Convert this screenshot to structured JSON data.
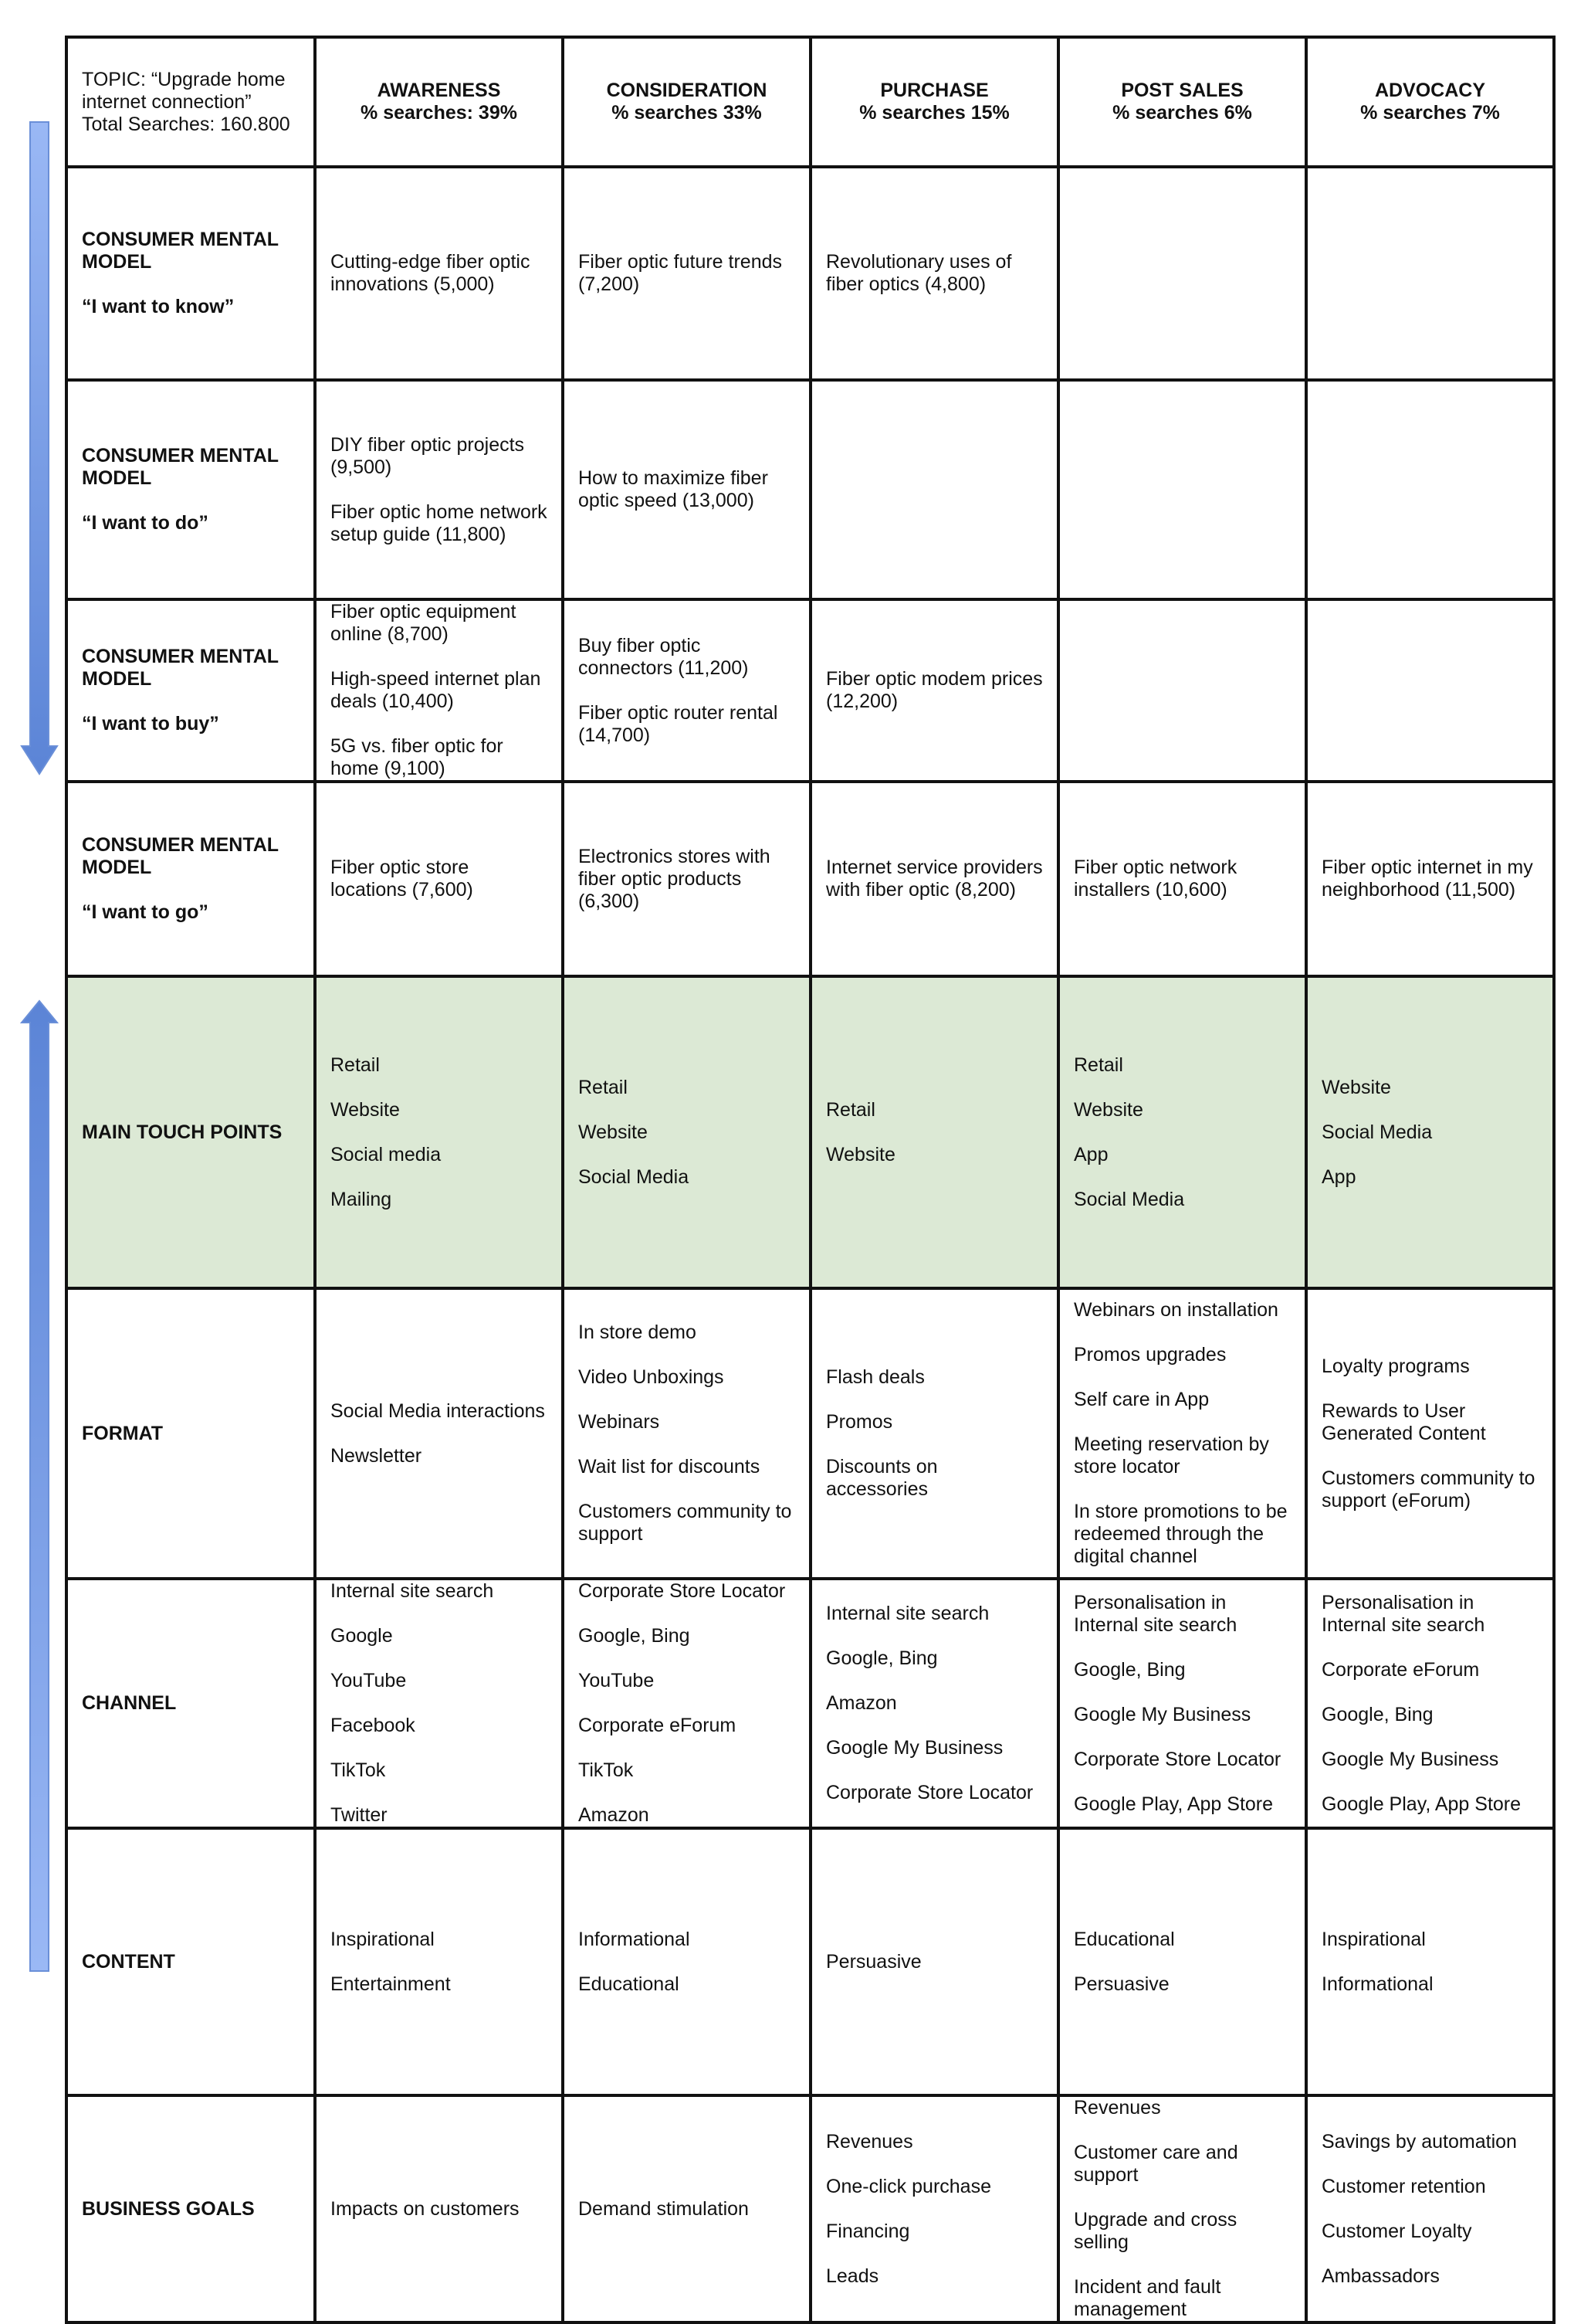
{
  "colors": {
    "border": "#111111",
    "touchpoints_bg": "#dce9d5",
    "arrow_down": "#5b84d6",
    "arrow_up": "#5b84d6",
    "arrow_light": "#9ab8f5"
  },
  "topic": {
    "line1": "TOPIC: “Upgrade home internet connection”",
    "line2": "Total Searches: 160.800"
  },
  "stages": [
    {
      "name": "AWARENESS",
      "searches": "% searches: 39%"
    },
    {
      "name": "CONSIDERATION",
      "searches": "% searches 33%"
    },
    {
      "name": "PURCHASE",
      "searches": "% searches 15%"
    },
    {
      "name": "POST SALES",
      "searches": "% searches 6%"
    },
    {
      "name": "ADVOCACY",
      "searches": "% searches 7%"
    }
  ],
  "rows": [
    {
      "label": "CONSUMER MENTAL MODEL",
      "sub": "“I want to know”",
      "cells": [
        [
          "Cutting-edge fiber optic innovations (5,000)"
        ],
        [
          "Fiber optic future trends (7,200)"
        ],
        [
          "Revolutionary uses of fiber optics (4,800)"
        ],
        [],
        []
      ]
    },
    {
      "label": "CONSUMER MENTAL MODEL",
      "sub": "“I want to do”",
      "cells": [
        [
          "DIY fiber optic projects (9,500)",
          "Fiber optic home network setup guide (11,800)"
        ],
        [
          "How to maximize fiber optic speed (13,000)"
        ],
        [],
        [],
        []
      ]
    },
    {
      "label": "CONSUMER MENTAL MODEL",
      "sub": "“I want to buy”",
      "cells": [
        [
          "Fiber optic equipment online (8,700)",
          "High-speed internet plan deals (10,400)",
          "5G vs. fiber optic for home (9,100)"
        ],
        [
          "Buy fiber optic connectors (11,200)",
          "Fiber optic router rental (14,700)"
        ],
        [
          "Fiber optic modem prices (12,200)"
        ],
        [],
        []
      ]
    },
    {
      "label": "CONSUMER MENTAL MODEL",
      "sub": "“I want to go”",
      "cells": [
        [
          "Fiber optic store locations (7,600)"
        ],
        [
          "Electronics stores with fiber optic products (6,300)"
        ],
        [
          "Internet service providers with fiber optic (8,200)"
        ],
        [
          "Fiber optic network installers (10,600)"
        ],
        [
          "Fiber optic internet in my neighborhood (11,500)"
        ]
      ]
    },
    {
      "label": "MAIN TOUCH POINTS",
      "sub": "",
      "cells": [
        [
          "Retail",
          "Website",
          "Social media",
          "Mailing"
        ],
        [
          "Retail",
          "Website",
          "Social Media"
        ],
        [
          "Retail",
          "Website"
        ],
        [
          "Retail",
          "Website",
          "App",
          "Social Media"
        ],
        [
          "Website",
          "Social Media",
          "App"
        ]
      ]
    },
    {
      "label": "FORMAT",
      "sub": "",
      "cells": [
        [
          "Social Media interactions",
          "Newsletter"
        ],
        [
          "In store demo",
          "Video Unboxings",
          "Webinars",
          "Wait list for discounts",
          "Customers community to support"
        ],
        [
          "Flash deals",
          "Promos",
          "Discounts on accessories"
        ],
        [
          "Webinars on installation",
          "Promos upgrades",
          "Self care in App",
          "Meeting reservation by store locator",
          "In store promotions to be redeemed through the digital channel"
        ],
        [
          "Loyalty programs",
          "Rewards to User Generated Content",
          "Customers community to support (eForum)"
        ]
      ]
    },
    {
      "label": "CHANNEL",
      "sub": "",
      "cells": [
        [
          "Internal site search",
          "Google",
          "YouTube",
          "Facebook",
          "TikTok",
          "Twitter"
        ],
        [
          "Corporate Store Locator",
          "Google, Bing",
          "YouTube",
          "Corporate eForum",
          "TikTok",
          "Amazon"
        ],
        [
          "Internal site search",
          "Google, Bing",
          "Amazon",
          "Google My Business",
          "Corporate Store Locator"
        ],
        [
          "Personalisation in Internal site search",
          "Google, Bing",
          "Google My Business",
          "Corporate Store Locator",
          "Google Play, App Store"
        ],
        [
          "Personalisation in Internal site search",
          "Corporate eForum",
          "Google, Bing",
          "Google My Business",
          "Google Play, App Store"
        ]
      ]
    },
    {
      "label": "CONTENT",
      "sub": "",
      "cells": [
        [
          "Inspirational",
          "Entertainment"
        ],
        [
          "Informational",
          "Educational"
        ],
        [
          "Persuasive"
        ],
        [
          "Educational",
          "Persuasive"
        ],
        [
          "Inspirational",
          "Informational"
        ]
      ]
    },
    {
      "label": "BUSINESS GOALS",
      "sub": "",
      "cells": [
        [
          "Impacts on customers"
        ],
        [
          "Demand stimulation"
        ],
        [
          "Revenues",
          "One-click purchase",
          "Financing",
          "Leads"
        ],
        [
          "Revenues",
          "Customer care and support",
          "Upgrade and cross selling",
          "Incident and fault management"
        ],
        [
          "Savings by automation",
          "Customer retention",
          "Customer Loyalty",
          "Ambassadors"
        ]
      ]
    }
  ]
}
